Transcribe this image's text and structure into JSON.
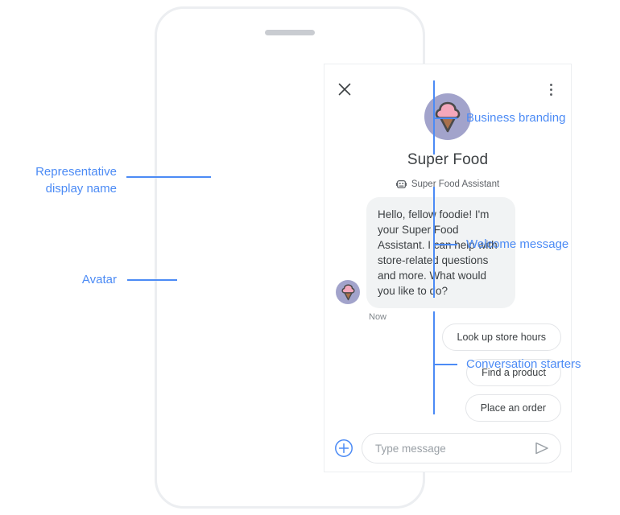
{
  "phone": {
    "speaker_name": "speaker-grille"
  },
  "chat": {
    "close_icon": "close-icon",
    "menu_icon": "overflow-menu-icon",
    "business_name": "Super Food",
    "logo_icon": "ice-cream-cone-icon",
    "representative": {
      "icon": "bot-icon",
      "name": "Super Food Assistant"
    },
    "message": {
      "avatar_icon": "ice-cream-cone-avatar-icon",
      "text": "Hello, fellow foodie! I'm your Super Food Assistant. I can help with store-related questions and more. What would you like to do?",
      "timestamp": "Now"
    },
    "suggestions": [
      {
        "label": "Look up store hours"
      },
      {
        "label": "Find a product"
      },
      {
        "label": "Place an order"
      }
    ],
    "composer": {
      "add_icon": "plus-circle-icon",
      "placeholder": "Type message",
      "value": "",
      "send_icon": "send-icon"
    }
  },
  "annotations": {
    "left": [
      {
        "label_line1": "Representative",
        "label_line2": "display name"
      },
      {
        "label_line1": "Avatar",
        "label_line2": ""
      }
    ],
    "right": [
      {
        "label": "Business branding"
      },
      {
        "label": "Welcome message"
      },
      {
        "label": "Conversation starters"
      }
    ]
  },
  "colors": {
    "accent_blue": "#4c8bf5",
    "avatar_purple": "#a2a3cb",
    "scoop_pink": "#f4a7bb",
    "cone_brown": "#a9714b",
    "bubble_gray": "#f1f3f4",
    "text_primary": "#3c4043",
    "text_secondary": "#5f6368"
  }
}
